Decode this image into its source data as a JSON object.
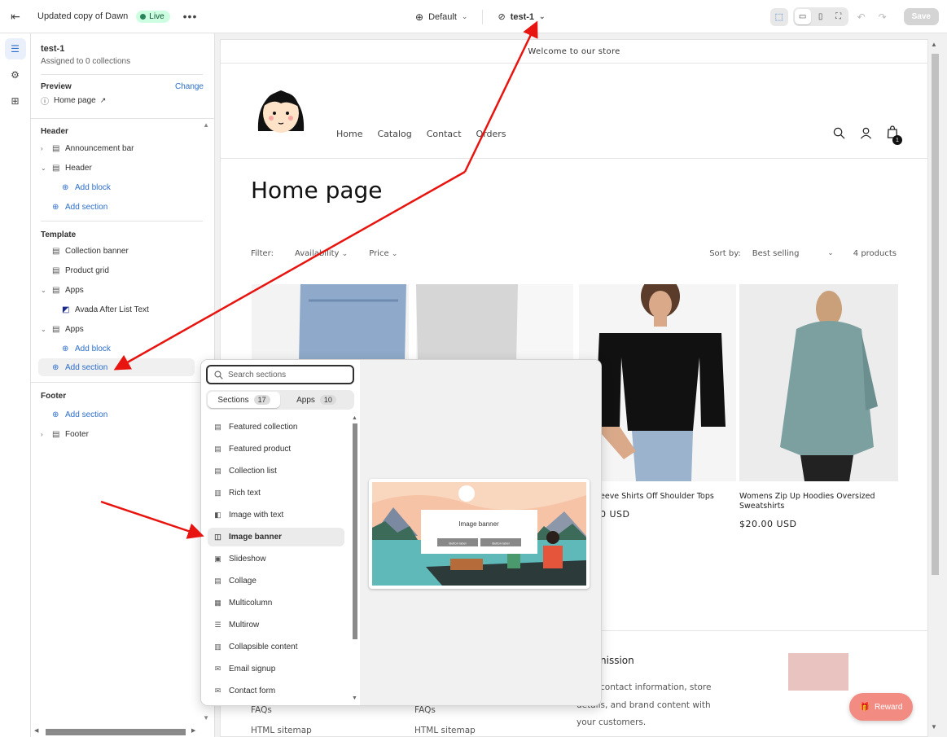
{
  "topbar": {
    "theme_name": "Updated copy of Dawn",
    "live_label": "Live",
    "more_label": "•••",
    "default_label": "Default",
    "page_label": "test-1",
    "save_label": "Save"
  },
  "sidebar": {
    "title": "test-1",
    "subtitle": "Assigned to 0 collections",
    "preview_label": "Preview",
    "change_label": "Change",
    "preview_page": "Home page",
    "header_group": "Header",
    "announcement_bar": "Announcement bar",
    "header_item": "Header",
    "add_block_1": "Add block",
    "add_section_header": "Add section",
    "template_group": "Template",
    "collection_banner": "Collection banner",
    "product_grid": "Product grid",
    "apps_1": "Apps",
    "avada_app": "Avada After List Text",
    "apps_2": "Apps",
    "add_block_2": "Add block",
    "add_section_template": "Add section",
    "footer_group": "Footer",
    "add_section_footer": "Add section",
    "footer_item": "Footer"
  },
  "store": {
    "announcement": "Welcome to our store",
    "nav": [
      "Home",
      "Catalog",
      "Contact",
      "Orders"
    ],
    "cart_count": "1",
    "page_title": "Home page",
    "filter_label": "Filter:",
    "availability": "Availability",
    "price": "Price",
    "sort_label": "Sort by:",
    "sort_value": "Best selling",
    "product_count": "4 products",
    "product3_name": "eeve Shirts Off Shoulder Tops",
    "product3_price": "0 USD",
    "product4_name_line1": "Womens Zip Up Hoodies Oversized",
    "product4_name_line2": "Sweatshirts",
    "product4_price": "$20.00 USD",
    "footer_heading": "nission",
    "footer_text_1": "contact information, store",
    "footer_text_2": "details, and brand content with",
    "footer_text_3": "your customers.",
    "footer_link_1a": "FAQs",
    "footer_link_1b": "HTML sitemap",
    "footer_link_2a": "FAQs",
    "footer_link_2b": "HTML sitemap",
    "reward_label": "Reward"
  },
  "popup": {
    "search_placeholder": "Search sections",
    "tab_sections": "Sections",
    "tab_sections_count": "17",
    "tab_apps": "Apps",
    "tab_apps_count": "10",
    "items": [
      {
        "label": "Featured collection",
        "icon": "layout-icon"
      },
      {
        "label": "Featured product",
        "icon": "layout-icon"
      },
      {
        "label": "Collection list",
        "icon": "layout-icon"
      },
      {
        "label": "Rich text",
        "icon": "text-icon"
      },
      {
        "label": "Image with text",
        "icon": "image-text-icon"
      },
      {
        "label": "Image banner",
        "icon": "image-icon"
      },
      {
        "label": "Slideshow",
        "icon": "slideshow-icon"
      },
      {
        "label": "Collage",
        "icon": "layout-icon"
      },
      {
        "label": "Multicolumn",
        "icon": "columns-icon"
      },
      {
        "label": "Multirow",
        "icon": "rows-icon"
      },
      {
        "label": "Collapsible content",
        "icon": "text-icon"
      },
      {
        "label": "Email signup",
        "icon": "mail-icon"
      },
      {
        "label": "Contact form",
        "icon": "mail-icon"
      }
    ],
    "selected_index": 5,
    "preview_title": "Image banner",
    "preview_button_1": "Button label",
    "preview_button_2": "Button label"
  },
  "colors": {
    "accent": "#2c6ecb",
    "live_bg": "#cdfee1",
    "arrow": "#e8140f",
    "reward": "#f28b82"
  }
}
